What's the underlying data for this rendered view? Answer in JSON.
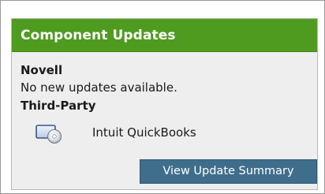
{
  "panel": {
    "title": "Component Updates",
    "header_color": "#4f9b20"
  },
  "sections": {
    "novell": {
      "heading": "Novell",
      "status": "No new updates available."
    },
    "third_party": {
      "heading": "Third-Party",
      "items": [
        {
          "label": "Intuit QuickBooks",
          "icon": "software-disc-icon"
        }
      ]
    }
  },
  "actions": {
    "view_summary_label": "View Update Summary",
    "button_color": "#3f6e8c"
  }
}
